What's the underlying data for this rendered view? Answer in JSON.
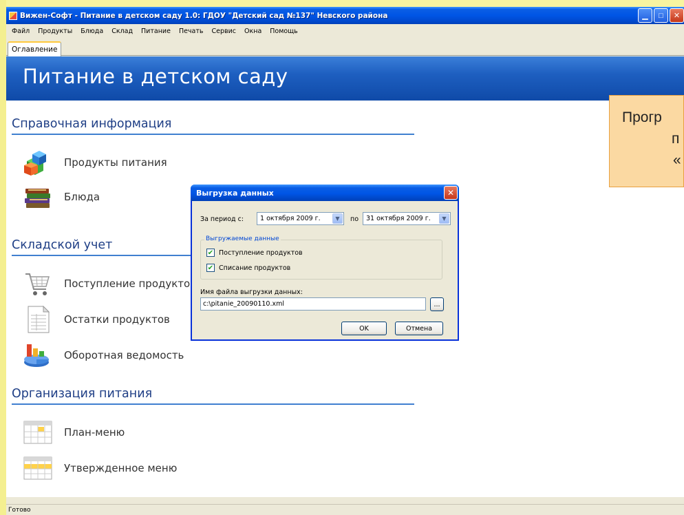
{
  "window": {
    "title": "Вижен-Софт - Питание в детском саду 1.0: ГДОУ \"Детский сад №137\" Невского района"
  },
  "menu": [
    "Файл",
    "Продукты",
    "Блюда",
    "Склад",
    "Питание",
    "Печать",
    "Сервис",
    "Окна",
    "Помощь"
  ],
  "tab": {
    "label": "Оглавление"
  },
  "banner": {
    "title": "Питание в детском саду"
  },
  "sections": [
    {
      "title": "Справочная информация",
      "items": [
        "Продукты питания",
        "Блюда"
      ]
    },
    {
      "title": "Складской учет",
      "items": [
        "Поступление продуктов",
        "Остатки продуктов",
        "Оборотная ведомость"
      ]
    },
    {
      "title": "Организация питания",
      "items": [
        "План-меню",
        "Утвержденное меню"
      ]
    }
  ],
  "dialog": {
    "title": "Выгрузка данных",
    "period_from_label": "За период с:",
    "date_from": "1 октября 2009 г.",
    "period_to_label": "по",
    "date_to": "31 октября 2009 г.",
    "group_title": "Выгружаемые данные",
    "checkboxes": [
      "Поступление продуктов",
      "Списание продуктов"
    ],
    "file_label": "Имя файла выгрузки данных:",
    "file_value": "c:\\pitanie_20090110.xml",
    "browse_label": "...",
    "ok_label": "OK",
    "cancel_label": "Отмена"
  },
  "callout": {
    "line1": "Прогр",
    "line2": "п",
    "line3": "«"
  },
  "status": {
    "text": "Готово"
  }
}
